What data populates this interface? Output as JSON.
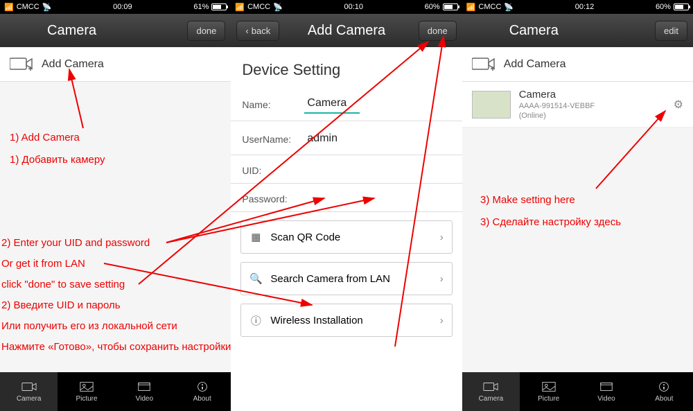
{
  "status": {
    "carrier": "CMCC",
    "time1": "00:09",
    "time2": "00:10",
    "time3": "00:12",
    "bat1": "61%",
    "bat2": "60%",
    "bat3": "60%"
  },
  "s1": {
    "title": "Camera",
    "done": "done",
    "addCamera": "Add Camera"
  },
  "s2": {
    "back": "back",
    "title": "Add Camera",
    "done": "done",
    "deviceSetting": "Device Setting",
    "nameLabel": "Name:",
    "nameValue": "Camera",
    "userLabel": "UserName:",
    "userValue": "admin",
    "uidLabel": "UID:",
    "uidValue": "",
    "passLabel": "Password:",
    "passValue": "",
    "scanQR": "Scan QR Code",
    "searchLAN": "Search Camera from LAN",
    "wireless": "Wireless Installation"
  },
  "s3": {
    "title": "Camera",
    "edit": "edit",
    "addCamera": "Add Camera",
    "camName": "Camera",
    "camId": "AAAA-991514-VEBBF",
    "camStatus": "(Online)"
  },
  "tabs": {
    "camera": "Camera",
    "picture": "Picture",
    "video": "Video",
    "about": "About"
  },
  "ann": {
    "a1": "1) Add Camera",
    "a1r": "1) Добавить камеру",
    "a2": "2) Enter your UID and password",
    "a2b": "Or get it from LAN",
    "a2c": "click \"done\" to save setting",
    "a2r": "2) Введите UID и пароль",
    "a2rb": "Или получить его из локальной сети",
    "a2rc": "Нажмите «Готово», чтобы сохранить настройки",
    "a3": "3) Make setting here",
    "a3r": "3) Сделайте настройку здесь"
  }
}
